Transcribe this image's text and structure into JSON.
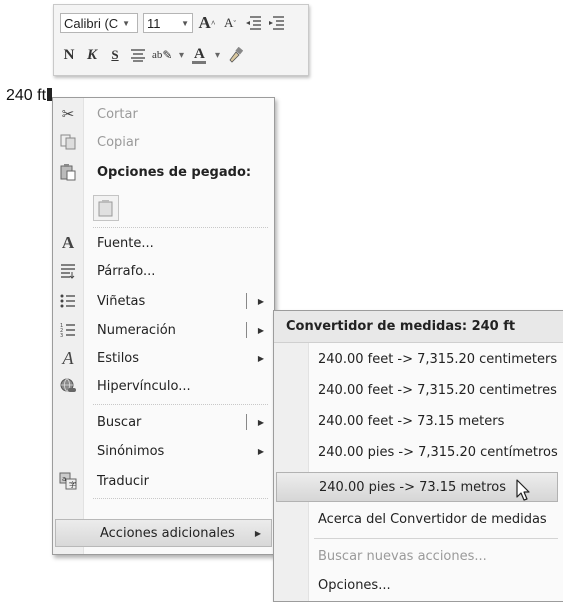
{
  "mini_toolbar": {
    "font_name": "Calibri (C",
    "font_size": "11",
    "row1_icons": [
      "grow-font-icon",
      "shrink-font-icon",
      "decrease-indent-icon",
      "increase-indent-icon"
    ],
    "grow_font": "A",
    "shrink_font": "A",
    "bold": "N",
    "italic": "K",
    "underline": "S",
    "highlight": "ab",
    "font_color": "A"
  },
  "document": {
    "selected_text": "240 ft"
  },
  "context_menu": {
    "items": [
      {
        "label": "Cortar",
        "icon": "scissors-icon",
        "disabled": true
      },
      {
        "label": "Copiar",
        "icon": "copy-icon",
        "disabled": true
      },
      {
        "label": "Opciones de pegado:",
        "icon": "paste-icon",
        "header": true
      },
      {
        "label": "Fuente...",
        "icon": "font-icon",
        "glyph": "A"
      },
      {
        "label": "Párrafo...",
        "icon": "paragraph-icon"
      },
      {
        "label": "Viñetas",
        "icon": "bullets-icon",
        "submenu": true
      },
      {
        "label": "Numeración",
        "icon": "numbering-icon",
        "submenu": true
      },
      {
        "label": "Estilos",
        "icon": "styles-icon",
        "submenu": true
      },
      {
        "label": "Hipervínculo...",
        "icon": "hyperlink-icon"
      },
      {
        "label": "Buscar",
        "submenu": true
      },
      {
        "label": "Sinónimos",
        "submenu": true
      },
      {
        "label": "Traducir",
        "icon": "translate-icon"
      },
      {
        "label": "Acciones adicionales",
        "submenu": true,
        "selected": true
      }
    ]
  },
  "submenu": {
    "header": "Convertidor de medidas: 240 ft",
    "items": [
      {
        "label": "240.00 feet -> 7,315.20 centimeters"
      },
      {
        "label": "240.00 feet -> 7,315.20 centimetres"
      },
      {
        "label": "240.00 feet -> 73.15 meters"
      },
      {
        "label": "240.00 pies -> 7,315.20 centímetros"
      },
      {
        "label": "240.00 pies -> 73.15 metros",
        "selected": true
      },
      {
        "label": "Acerca del Convertidor de medidas"
      },
      {
        "label": "Buscar nuevas acciones...",
        "disabled": true
      },
      {
        "label": "Opciones..."
      }
    ]
  }
}
